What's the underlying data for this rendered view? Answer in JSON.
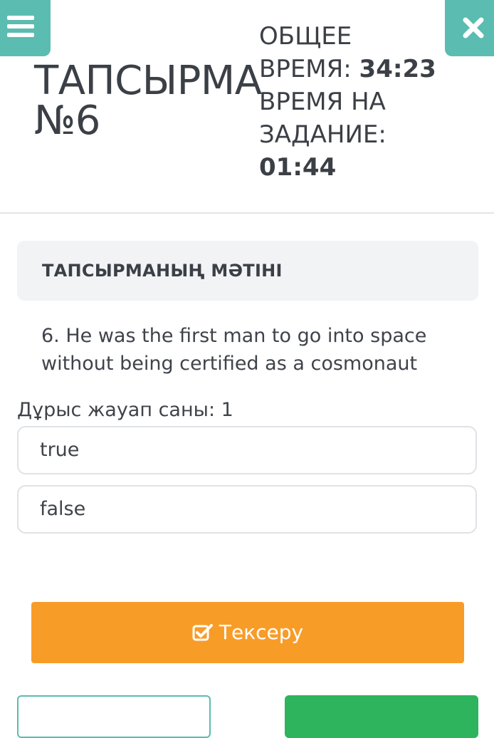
{
  "header": {
    "task_title_line1": "ТАПСЫРМА",
    "task_title_line2": "№6",
    "total_time_label_line1": "ОБЩЕЕ",
    "total_time_label_line2": "ВРЕМЯ:",
    "total_time_value": "34:23",
    "task_time_label_line1": "ВРЕМЯ НА",
    "task_time_label_line2": "ЗАДАНИЕ:",
    "task_time_value": "01:44",
    "menu_icon": "hamburger-menu-icon",
    "close_icon": "close-icon"
  },
  "task_card": {
    "title": "ТАПСЫРМАНЫҢ МӘТІНІ"
  },
  "question": {
    "text_line1": "6. He was the first man to go into space",
    "text_line2": "without being certified as a cosmonaut",
    "correct_count_label": "Дұрыс жауап саны: 1"
  },
  "options": [
    {
      "label": "true"
    },
    {
      "label": "false"
    }
  ],
  "check_button": {
    "label": "Тексеру",
    "icon": "checkbox-icon"
  },
  "colors": {
    "accent_teal": "#5bbcb1",
    "orange": "#f89c28",
    "green": "#2db45d"
  }
}
